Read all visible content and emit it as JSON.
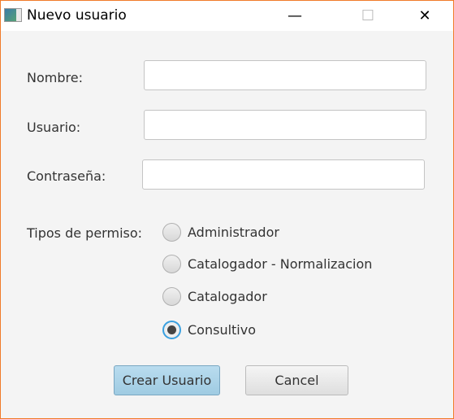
{
  "window": {
    "title": "Nuevo usuario",
    "minimize": "—",
    "maximize": "☐",
    "close": "✕"
  },
  "form": {
    "nombre_label": "Nombre:",
    "nombre_value": "",
    "usuario_label": "Usuario:",
    "usuario_value": "",
    "password_label": "Contraseña:",
    "password_value": "",
    "permisos_label": "Tipos de permiso:",
    "permisos": [
      {
        "label": "Administrador",
        "selected": false
      },
      {
        "label": "Catalogador - Normalizacion",
        "selected": false
      },
      {
        "label": "Catalogador",
        "selected": false
      },
      {
        "label": "Consultivo",
        "selected": true
      }
    ]
  },
  "buttons": {
    "create": "Crear Usuario",
    "cancel": "Cancel"
  }
}
